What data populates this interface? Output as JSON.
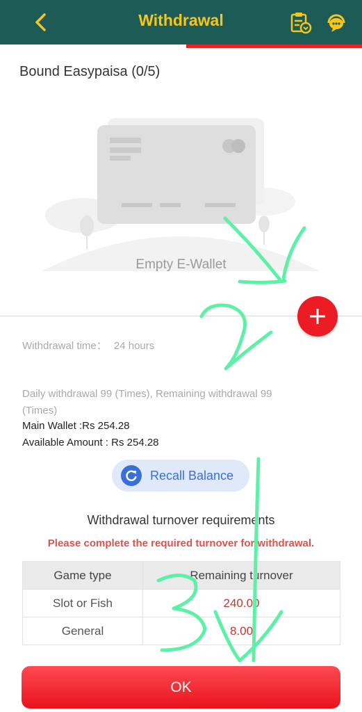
{
  "header": {
    "title": "Withdrawal",
    "back_icon": "chevron-left-icon",
    "records_icon": "clipboard-download-icon",
    "support_icon": "customer-service-icon"
  },
  "wallet": {
    "bound_label": "Bound Easypaisa (0/5)",
    "empty_text": "Empty E-Wallet",
    "add_icon": "plus-icon"
  },
  "info": {
    "withdrawal_time_label": "Withdrawal time：",
    "withdrawal_time_value": "24 hours",
    "daily_limit_line1": "Daily withdrawal 99 (Times), Remaining withdrawal 99",
    "daily_limit_line2": "(Times)",
    "main_wallet": "Main Wallet :Rs 254.28",
    "available_amount": "Available Amount : Rs 254.28"
  },
  "recall": {
    "label": "Recall Balance",
    "icon": "refresh-icon"
  },
  "turnover": {
    "title": "Withdrawal turnover requirements",
    "warning": "Please complete the required turnover for withdrawal.",
    "headers": [
      "Game type",
      "Remaining turnover"
    ],
    "rows": [
      {
        "type": "Slot or Fish",
        "remaining": "240.00"
      },
      {
        "type": "General",
        "remaining": "8.00"
      }
    ]
  },
  "ok_label": "OK",
  "colors": {
    "header_bg": "#1d5b57",
    "title": "#f6c61b",
    "accent_red": "#ec1c24",
    "recall_blue": "#3a6fd8",
    "annotation": "#5ff0a8"
  }
}
